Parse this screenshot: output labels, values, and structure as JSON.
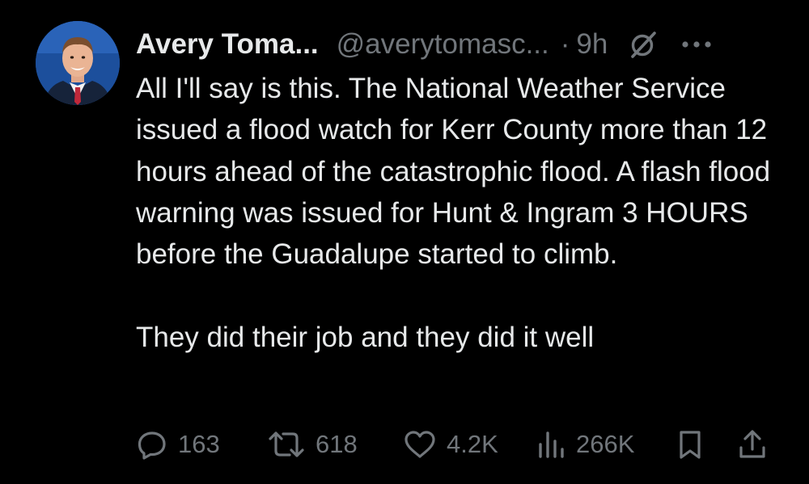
{
  "post": {
    "author": {
      "display_name": "Avery Toma...",
      "handle": "@averytomasc...",
      "avatar_icon": "profile-photo"
    },
    "separator": "·",
    "time": "9h",
    "paragraphs": [
      "All I'll say is this. The National Weather Service issued a flood watch for Kerr County more than 12 hours ahead of the catastrophic flood. A flash flood warning was issued for Hunt & Ingram 3 HOURS before the Guadalupe started to climb.",
      "They did their job and they did it well"
    ],
    "actions": {
      "replies": "163",
      "reposts": "618",
      "likes": "4.2K",
      "views": "266K"
    }
  },
  "colors": {
    "background": "#000000",
    "primary_text": "#e7e9ea",
    "secondary_text": "#71767b"
  }
}
